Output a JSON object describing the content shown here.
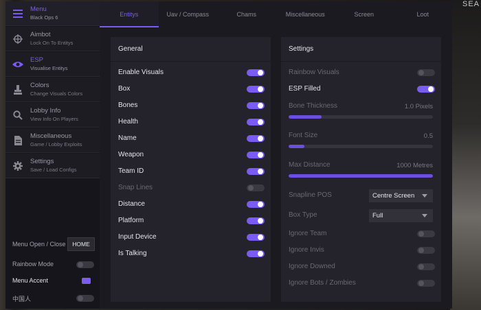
{
  "background": {
    "corner_text": "SEA"
  },
  "sidebar": {
    "items": [
      {
        "title": "Menu",
        "subtitle": "Black Ops 6",
        "icon": "hamburger-icon"
      },
      {
        "title": "Aimbot",
        "subtitle": "Lock On To Entitys",
        "icon": "crosshair-icon"
      },
      {
        "title": "ESP",
        "subtitle": "Visualise Entitys",
        "icon": "eye-icon"
      },
      {
        "title": "Colors",
        "subtitle": "Change Visuals Colors",
        "icon": "paint-icon"
      },
      {
        "title": "Lobby Info",
        "subtitle": "View Info On Players",
        "icon": "search-icon"
      },
      {
        "title": "Miscellaneous",
        "subtitle": "Game / Lobby Exploits",
        "icon": "file-icon"
      },
      {
        "title": "Settings",
        "subtitle": "Save / Load Configs",
        "icon": "gear-icon"
      }
    ],
    "menu_open_label": "Menu Open / Close",
    "menu_open_key": "HOME",
    "rainbow_mode_label": "Rainbow Mode",
    "rainbow_mode_on": false,
    "menu_accent_label": "Menu Accent",
    "menu_accent_color": "#7b5cf0",
    "chinese_label": "中国人",
    "chinese_on": false
  },
  "tabs": [
    "Entitys",
    "Uav / Compass",
    "Chams",
    "Miscellaneous",
    "Screen",
    "Loot"
  ],
  "active_tab": "Entitys",
  "general": {
    "header": "General",
    "options": [
      {
        "label": "Enable Visuals",
        "on": true
      },
      {
        "label": "Box",
        "on": true
      },
      {
        "label": "Bones",
        "on": true
      },
      {
        "label": "Health",
        "on": true
      },
      {
        "label": "Name",
        "on": true
      },
      {
        "label": "Weapon",
        "on": true
      },
      {
        "label": "Team ID",
        "on": true
      },
      {
        "label": "Snap Lines",
        "on": false,
        "disabled": true
      },
      {
        "label": "Distance",
        "on": true
      },
      {
        "label": "Platform",
        "on": true
      },
      {
        "label": "Input Device",
        "on": true
      },
      {
        "label": "Is Talking",
        "on": true
      }
    ]
  },
  "settings": {
    "header": "Settings",
    "rainbow_visuals": {
      "label": "Rainbow Visuals",
      "on": false
    },
    "esp_filled": {
      "label": "ESP Filled",
      "on": true
    },
    "bone_thickness": {
      "label": "Bone Thickness",
      "value": "1.0 Pixels",
      "fraction": 0.23
    },
    "font_size": {
      "label": "Font Size",
      "value": "0.5",
      "fraction": 0.11
    },
    "max_distance": {
      "label": "Max Distance",
      "value": "1000 Metres",
      "fraction": 1.0
    },
    "snapline_pos": {
      "label": "Snapline POS",
      "value": "Centre Screen"
    },
    "box_type": {
      "label": "Box Type",
      "value": "Full"
    },
    "ignore_team": {
      "label": "Ignore Team",
      "on": false
    },
    "ignore_invis": {
      "label": "Ignore Invis",
      "on": false
    },
    "ignore_downed": {
      "label": "Ignore Downed",
      "on": false
    },
    "ignore_bots": {
      "label": "Ignore Bots / Zombies",
      "on": false
    }
  },
  "colors": {
    "accent": "#7b5cf0",
    "panel": "#24232b",
    "window": "#1b1a21"
  }
}
